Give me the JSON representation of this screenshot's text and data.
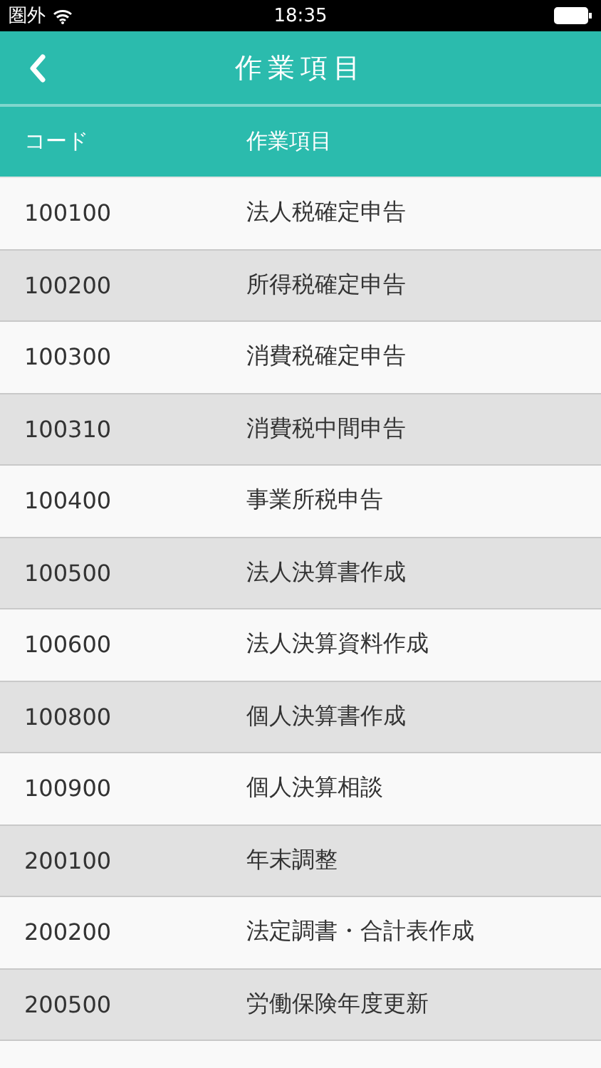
{
  "status_bar": {
    "carrier": "圏外",
    "time": "18:35"
  },
  "nav": {
    "title": "作業項目"
  },
  "table": {
    "columns": [
      "コード",
      "作業項目"
    ],
    "rows": [
      {
        "code": "100100",
        "name": "法人税確定申告"
      },
      {
        "code": "100200",
        "name": "所得税確定申告"
      },
      {
        "code": "100300",
        "name": "消費税確定申告"
      },
      {
        "code": "100310",
        "name": "消費税中間申告"
      },
      {
        "code": "100400",
        "name": "事業所税申告"
      },
      {
        "code": "100500",
        "name": "法人決算書作成"
      },
      {
        "code": "100600",
        "name": "法人決算資料作成"
      },
      {
        "code": "100800",
        "name": "個人決算書作成"
      },
      {
        "code": "100900",
        "name": "個人決算相談"
      },
      {
        "code": "200100",
        "name": "年末調整"
      },
      {
        "code": "200200",
        "name": "法定調書・合計表作成"
      },
      {
        "code": "200500",
        "name": "労働保険年度更新"
      }
    ]
  }
}
